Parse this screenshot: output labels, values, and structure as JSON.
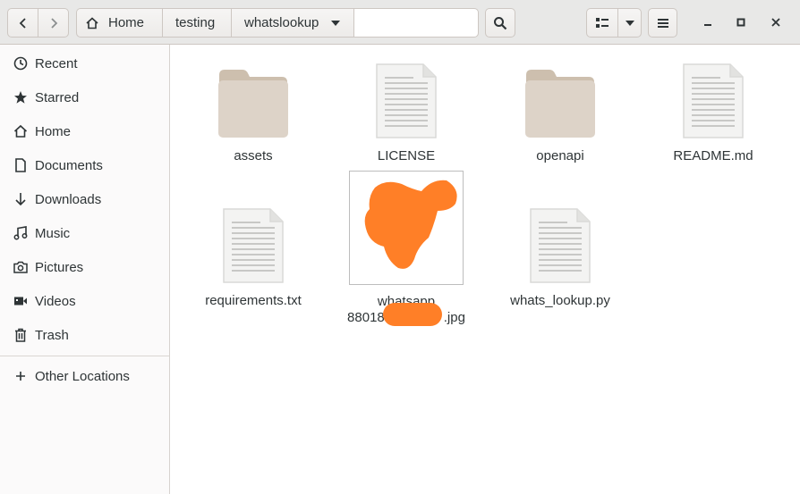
{
  "header": {
    "breadcrumbs": [
      "Home",
      "testing",
      "whatslookup"
    ],
    "icons": {
      "back": "chevron-left-icon",
      "forward": "chevron-right-icon",
      "home": "home-icon",
      "dropdown": "triangle-down-icon",
      "search": "search-icon",
      "view": "list-view-icon",
      "menu": "hamburger-menu-icon",
      "minimize": "minimize-icon",
      "maximize": "maximize-icon",
      "close": "close-icon"
    }
  },
  "sidebar": {
    "items": [
      {
        "label": "Recent",
        "icon": "clock-icon"
      },
      {
        "label": "Starred",
        "icon": "star-icon"
      },
      {
        "label": "Home",
        "icon": "home-icon"
      },
      {
        "label": "Documents",
        "icon": "document-icon"
      },
      {
        "label": "Downloads",
        "icon": "download-arrow-icon"
      },
      {
        "label": "Music",
        "icon": "music-note-icon"
      },
      {
        "label": "Pictures",
        "icon": "camera-icon"
      },
      {
        "label": "Videos",
        "icon": "video-camera-icon"
      },
      {
        "label": "Trash",
        "icon": "trash-icon"
      }
    ],
    "other_locations": {
      "label": "Other Locations",
      "icon": "plus-icon"
    }
  },
  "files": [
    {
      "name": "assets",
      "type": "folder"
    },
    {
      "name": "LICENSE",
      "type": "text"
    },
    {
      "name": "openapi",
      "type": "folder"
    },
    {
      "name": "README.md",
      "type": "text"
    },
    {
      "name": "requirements.txt",
      "type": "text"
    },
    {
      "name_line1": "whatsapp",
      "name_line2_prefix": "88018",
      "name_line2_suffix": ".jpg",
      "type": "image"
    },
    {
      "name": "whats_lookup.py",
      "type": "text"
    }
  ],
  "colors": {
    "redaction": "#ff7f27",
    "folder": "#ddd3c8",
    "folder_tab": "#cdbfae"
  }
}
